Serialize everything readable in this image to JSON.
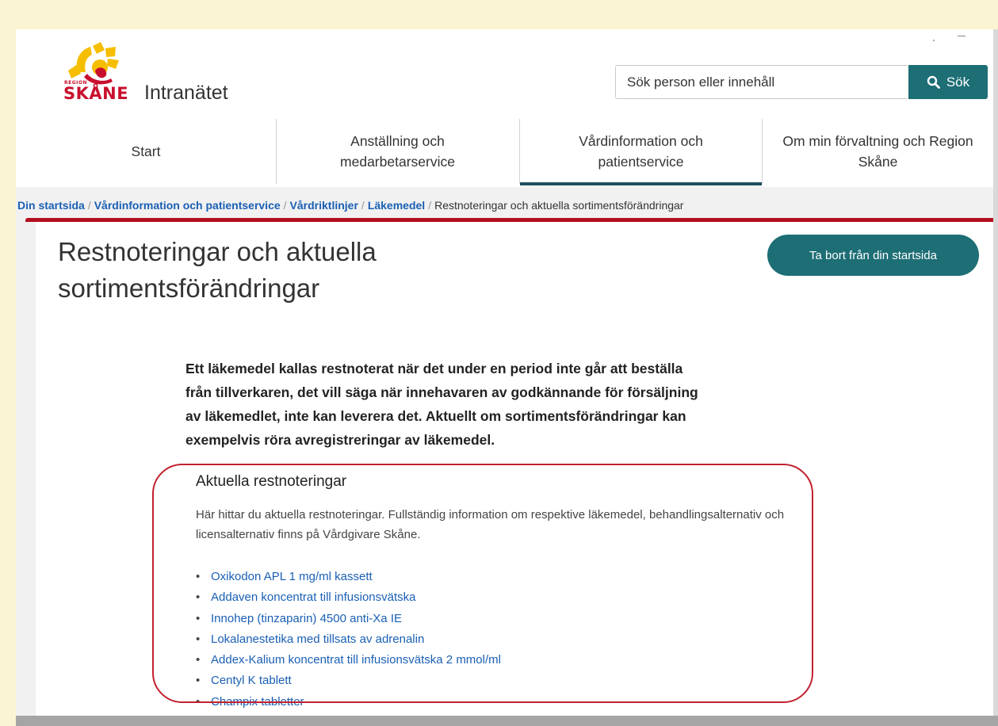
{
  "header": {
    "logo": {
      "region_text": "REGION",
      "brand_text": "SKÅNE"
    },
    "app_title": "Intranätet",
    "search": {
      "placeholder": "Sök person eller innehåll",
      "button_label": "Sök"
    }
  },
  "nav": {
    "items": [
      {
        "label": "Start"
      },
      {
        "label": "Anställning och medarbetarservice"
      },
      {
        "label": "Vårdinformation och patientservice",
        "active": true
      },
      {
        "label": "Om min förvaltning och Region Skåne"
      }
    ]
  },
  "breadcrumb": {
    "links": [
      "Din startsida",
      "Vårdinformation och patientservice",
      "Vårdriktlinjer",
      "Läkemedel"
    ],
    "current": "Restnoteringar och aktuella sortimentsförändringar",
    "separator": "/"
  },
  "page": {
    "title": "Restnoteringar och aktuella sortimentsförändringar",
    "remove_button": "Ta bort från din startsida",
    "intro": "Ett läkemedel kallas restnoterat när det under en period inte går att beställa från tillverkaren, det vill säga när innehavaren av godkännande för försäljning av läkemedlet, inte kan leverera det. Aktuellt om sortimentsförändringar kan exempelvis röra avregistreringar av läkemedel."
  },
  "section": {
    "title": "Aktuella restnoteringar",
    "description": "Här hittar du aktuella restnoteringar. Fullständig information om respektive läkemedel, behandlingsalternativ och licensalternativ finns på Vårdgivare Skåne.",
    "bullet": "•",
    "items": [
      "Oxikodon APL 1 mg/ml kassett",
      "Addaven koncentrat till infusionsvätska",
      "Innohep (tinzaparin) 4500 anti-Xa IE",
      "Lokalanestetika med tillsats av adrenalin",
      "Addex-Kalium koncentrat till infusionsvätska 2 mmol/ml",
      "Centyl K tablett",
      "Champix tabletter"
    ]
  },
  "colors": {
    "accent_teal": "#1d6e75",
    "brand_red": "#c8102e",
    "link_blue": "#1a5fb4",
    "highlight_red": "#c2212f",
    "background_yellow": "#fbf4d2"
  },
  "icons": [
    "sun-logo-icon",
    "search-icon"
  ]
}
